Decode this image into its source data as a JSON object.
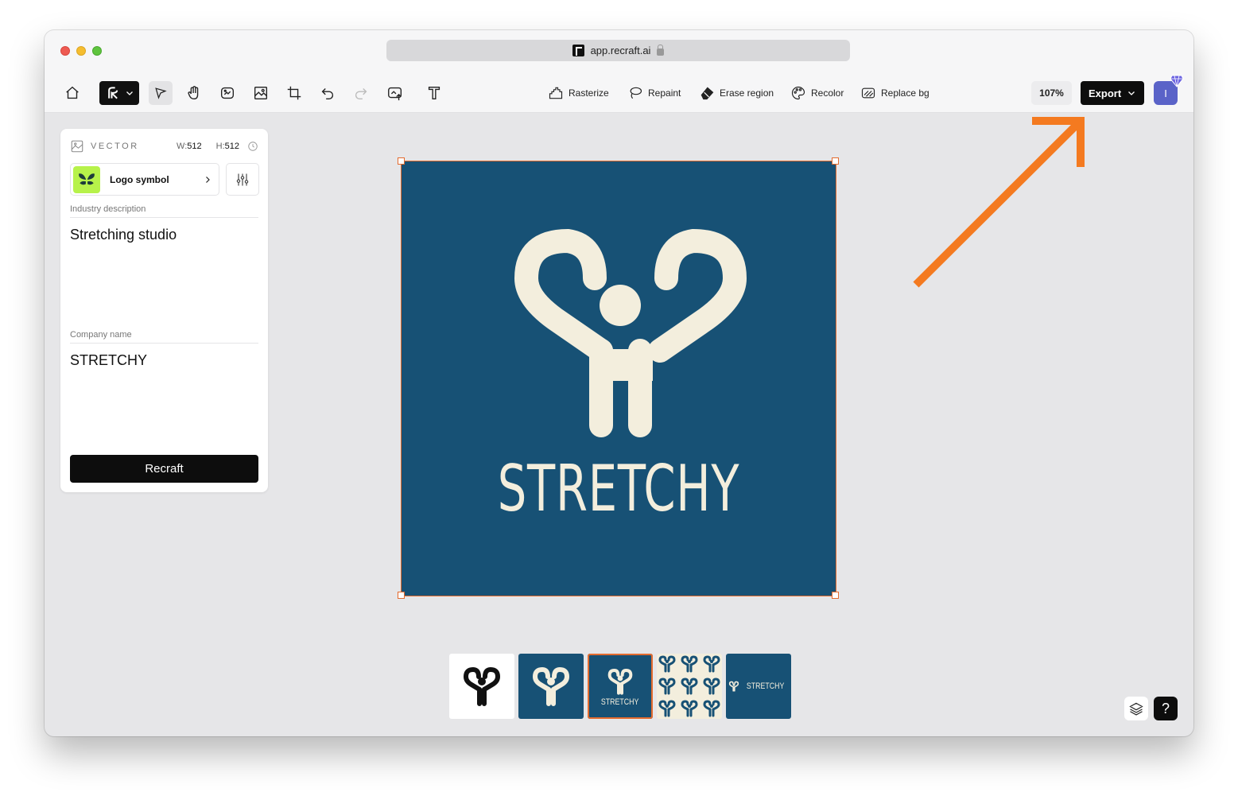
{
  "browser": {
    "url": "app.recraft.ai"
  },
  "toolbar": {
    "tools": [
      "Rasterize",
      "Repaint",
      "Erase region",
      "Recolor",
      "Replace bg"
    ],
    "zoom": "107%",
    "export_label": "Export",
    "avatar_initial": "I"
  },
  "panel": {
    "type_label": "VECTOR",
    "width_label": "W:",
    "width_value": "512",
    "height_label": "H:",
    "height_value": "512",
    "style_name": "Logo symbol",
    "industry_label": "Industry description",
    "industry_value": "Stretching studio",
    "company_label": "Company name",
    "company_value": "STRETCHY",
    "recraft_label": "Recraft"
  },
  "canvas": {
    "logo_text": "STRETCHY",
    "background_color": "#175175",
    "logo_color": "#f3eedd"
  },
  "thumbnails": {
    "labels": [
      "STRETCHY",
      "STRETCHY"
    ]
  },
  "colors": {
    "accent": "#e36b2e",
    "arrow": "#f47a20",
    "avatar": "#5a63c8"
  }
}
